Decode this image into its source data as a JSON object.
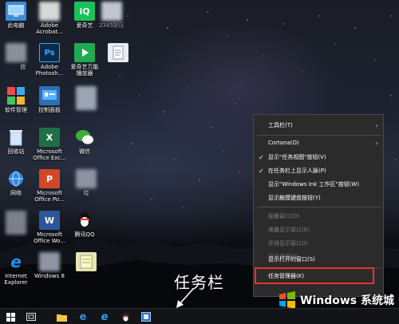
{
  "desktop": {
    "icons": [
      {
        "label": "此电脑"
      },
      {
        "label": "Adobe\nAcrobat..."
      },
      {
        "label": "爱奇艺"
      },
      {
        "label": "2345好压"
      },
      {
        "label": "应"
      },
      {
        "label": "Adobe\nPhotosh..."
      },
      {
        "label": "爱奇艺万能\n播放器"
      },
      {
        "label": "软件管理"
      },
      {
        "label": "控制面板"
      },
      {
        "label": "回收站"
      },
      {
        "label": "Microsoft\nOffice Exc..."
      },
      {
        "label": "微信"
      },
      {
        "label": "网络"
      },
      {
        "label": "Microsoft\nOffice Po..."
      },
      {
        "label": "垃"
      },
      {
        "label": "Microsoft\nOffice Wo..."
      },
      {
        "label": "腾讯QQ"
      },
      {
        "label": "Internet\nExplorer"
      },
      {
        "label": "Windows 8"
      }
    ]
  },
  "context_menu": {
    "items": [
      {
        "label": "工具栏(T)",
        "submenu": true
      },
      {
        "label": "Cortana(O)",
        "submenu": true
      },
      {
        "label": "显示\"任务视图\"按钮(V)",
        "checked": true
      },
      {
        "label": "在任务栏上显示人脉(P)",
        "checked": true
      },
      {
        "label": "显示\"Windows Ink 工作区\"按钮(W)"
      },
      {
        "label": "显示触摸键盘按钮(Y)"
      },
      {
        "label": "层叠窗口(D)",
        "disabled": true
      },
      {
        "label": "堆叠显示窗口(E)",
        "disabled": true
      },
      {
        "label": "并排显示窗口(I)",
        "disabled": true
      },
      {
        "label": "显示桌面(S)",
        "disabled": true
      },
      {
        "label": "显示打开的窗口(S)"
      },
      {
        "label": "任务管理器(K)"
      }
    ],
    "check_glyph": "✓",
    "submenu_glyph": "›"
  },
  "annotation": {
    "text": "任务栏"
  },
  "watermark": {
    "text": "Windows 系统城"
  },
  "colors": {
    "highlight": "#e5352c",
    "menu_bg": "#2b2b2b"
  }
}
